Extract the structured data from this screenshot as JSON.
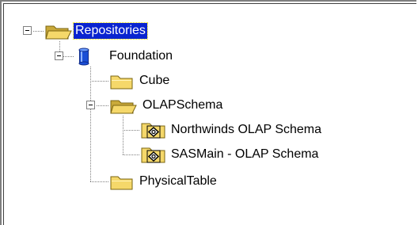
{
  "tree": {
    "root": {
      "label": "Repositories",
      "icon": "open-folder-icon",
      "selected": true
    },
    "foundation": {
      "label": "Foundation",
      "icon": "database-cylinder-icon"
    },
    "cube": {
      "label": "Cube",
      "icon": "folder-icon"
    },
    "olapschema": {
      "label": "OLAPSchema",
      "icon": "open-folder-icon"
    },
    "northwinds": {
      "label": "Northwinds OLAP Schema",
      "icon": "olap-schema-icon"
    },
    "sasmain": {
      "label": "SASMain - OLAP Schema",
      "icon": "olap-schema-icon"
    },
    "physicaltable": {
      "label": "PhysicalTable",
      "icon": "folder-icon"
    }
  },
  "colors": {
    "selection_bg": "#0a24d0",
    "folder_yellow": "#f5d86a",
    "database_blue": "#1b4fd6"
  }
}
